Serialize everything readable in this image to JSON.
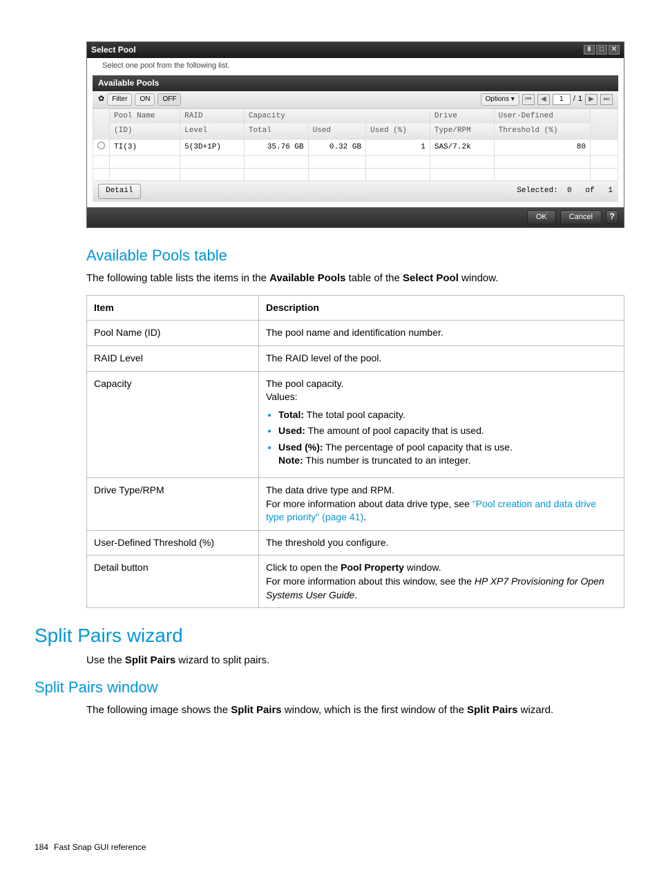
{
  "window": {
    "title": "Select Pool",
    "subtitle": "Select one pool from the following list.",
    "panel_header": "Available Pools",
    "filter_label": "Filter",
    "on_label": "ON",
    "off_label": "OFF",
    "options_label": "Options",
    "page_current": "1",
    "page_sep": "/",
    "page_total": "1",
    "columns": {
      "pool_name": "Pool Name",
      "pool_id": "(ID)",
      "raid": "RAID",
      "raid_level": "Level",
      "capacity": "Capacity",
      "cap_total": "Total",
      "cap_used": "Used",
      "cap_usedpct": "Used (%)",
      "drive": "Drive",
      "drive_type": "Type/RPM",
      "udt": "User-Defined",
      "udt_thresh": "Threshold (%)"
    },
    "row": {
      "pool_name": "TI(3)",
      "raid_level": "5(3D+1P)",
      "cap_total": "35.76 GB",
      "cap_used": "0.32 GB",
      "cap_usedpct": "1",
      "drive_type": "SAS/7.2k",
      "udt_thresh": "80"
    },
    "detail_btn": "Detail",
    "selected_label": "Selected:",
    "selected_count": "0",
    "of_label": "of",
    "total_count": "1",
    "ok": "OK",
    "cancel": "Cancel",
    "help": "?"
  },
  "section1": {
    "heading": "Available Pools table",
    "intro_pre": "The following table lists the items in the ",
    "intro_bold1": "Available Pools",
    "intro_mid": " table of the ",
    "intro_bold2": "Select Pool",
    "intro_post": " window."
  },
  "doctable": {
    "h_item": "Item",
    "h_desc": "Description",
    "r1_item": "Pool Name (ID)",
    "r1_desc": "The pool name and identification number.",
    "r2_item": "RAID Level",
    "r2_desc": "The RAID level of the pool.",
    "r3_item": "Capacity",
    "r3_line1": "The pool capacity.",
    "r3_line2": "Values:",
    "r3_b1_bold": "Total:",
    "r3_b1_rest": " The total pool capacity.",
    "r3_b2_bold": "Used:",
    "r3_b2_rest": " The amount of pool capacity that is used.",
    "r3_b3_bold": "Used (%):",
    "r3_b3_rest": " The percentage of pool capacity that is use.",
    "r3_note_bold": "Note:",
    "r3_note_rest": " This number is truncated to an integer.",
    "r4_item": "Drive Type/RPM",
    "r4_line1": "The data drive type and RPM.",
    "r4_line2_pre": "For more information about data drive type, see ",
    "r4_link": "\"Pool creation and data drive type priority\" (page 41)",
    "r4_line2_post": ".",
    "r5_item": "User-Defined Threshold (%)",
    "r5_desc": "The threshold you configure.",
    "r6_item": "Detail button",
    "r6_line1_pre": "Click to open the ",
    "r6_line1_bold": "Pool Property",
    "r6_line1_post": " window.",
    "r6_line2_pre": "For more information about this window, see the ",
    "r6_line2_italic": "HP XP7 Provisioning for Open Systems User Guide",
    "r6_line2_post": "."
  },
  "section2": {
    "heading": "Split Pairs wizard",
    "intro_pre": "Use the ",
    "intro_bold": "Split Pairs",
    "intro_post": " wizard to split pairs."
  },
  "section3": {
    "heading": "Split Pairs window",
    "intro_pre": "The following image shows the ",
    "intro_bold1": "Split Pairs",
    "intro_mid": " window, which is the first window of the ",
    "intro_bold2": "Split Pairs",
    "intro_post": " wizard."
  },
  "footer": {
    "page": "184",
    "text": "Fast Snap GUI reference"
  }
}
